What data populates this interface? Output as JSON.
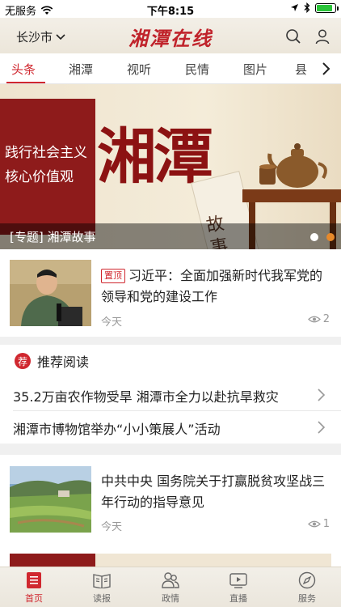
{
  "status": {
    "carrier": "无服务",
    "time": "下午8:15",
    "battery_level": 0.85
  },
  "header": {
    "city": "长沙市",
    "logo": "湘潭在线",
    "search_icon": "search-icon",
    "user_icon": "user-icon"
  },
  "tabs": [
    {
      "label": "头条",
      "active": true
    },
    {
      "label": "湘潭",
      "active": false
    },
    {
      "label": "视听",
      "active": false
    },
    {
      "label": "民情",
      "active": false
    },
    {
      "label": "图片",
      "active": false
    },
    {
      "label": "县",
      "active": false
    }
  ],
  "banner": {
    "slogan_line1": "践行社会主义",
    "slogan_line2": "核心价值观",
    "big_text": "湘潭",
    "paper_text": "故事",
    "caption": "[专题] 湘潭故事",
    "slide_count": 2,
    "active_slide": 2
  },
  "news": [
    {
      "badge": "置顶",
      "title": "习近平：全面加强新时代我军党的领导和党的建设工作",
      "time": "今天",
      "views": "2"
    },
    {
      "badge": "",
      "title": "中共中央 国务院关于打赢脱贫攻坚战三年行动的指导意见",
      "time": "今天",
      "views": "1"
    }
  ],
  "recommended": {
    "badge": "荐",
    "title": "推荐阅读",
    "items": [
      "35.2万亩农作物受旱 湘潭市全力以赴抗旱救灾",
      "湘潭市博物馆举办“小小策展人”活动"
    ]
  },
  "tabbar": [
    {
      "label": "首页",
      "icon": "home-icon",
      "active": true
    },
    {
      "label": "读报",
      "icon": "newspaper-icon",
      "active": false
    },
    {
      "label": "政情",
      "icon": "people-icon",
      "active": false
    },
    {
      "label": "直播",
      "icon": "live-icon",
      "active": false
    },
    {
      "label": "服务",
      "icon": "compass-icon",
      "active": false
    }
  ],
  "colors": {
    "accent": "#d0272f",
    "header_bg": "#efe9de"
  }
}
